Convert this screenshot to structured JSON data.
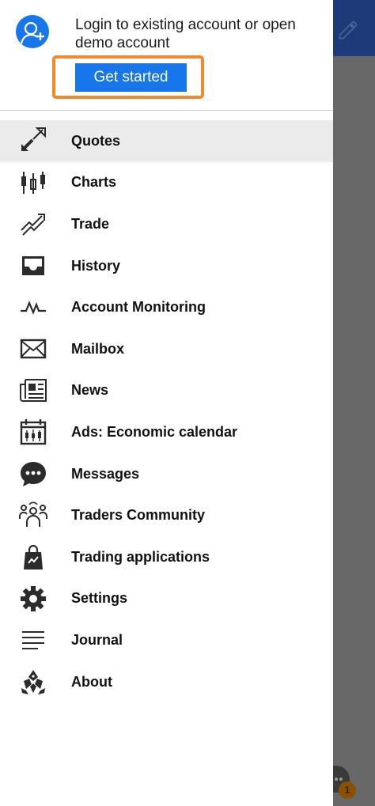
{
  "header": {
    "login_text": "Login to existing account or open demo account",
    "cta_label": "Get started"
  },
  "menu": {
    "items": [
      {
        "label": "Quotes",
        "icon": "quotes-icon",
        "active": true
      },
      {
        "label": "Charts",
        "icon": "charts-icon"
      },
      {
        "label": "Trade",
        "icon": "trade-icon"
      },
      {
        "label": "History",
        "icon": "history-icon"
      },
      {
        "label": "Account Monitoring",
        "icon": "monitoring-icon"
      },
      {
        "label": "Mailbox",
        "icon": "mailbox-icon"
      },
      {
        "label": "News",
        "icon": "news-icon"
      },
      {
        "label": "Ads: Economic calendar",
        "icon": "calendar-icon"
      },
      {
        "label": "Messages",
        "icon": "messages-icon"
      },
      {
        "label": "Traders Community",
        "icon": "community-icon"
      },
      {
        "label": "Trading applications",
        "icon": "apps-bag-icon"
      },
      {
        "label": "Settings",
        "icon": "gear-icon"
      },
      {
        "label": "Journal",
        "icon": "journal-icon"
      },
      {
        "label": "About",
        "icon": "about-logo-icon"
      }
    ]
  },
  "background": {
    "badge_count": "1"
  },
  "colors": {
    "accent": "#1776ea",
    "highlight_outline": "#f28a2c",
    "app_bar": "#1e3a78",
    "active_row": "#ebebeb"
  }
}
